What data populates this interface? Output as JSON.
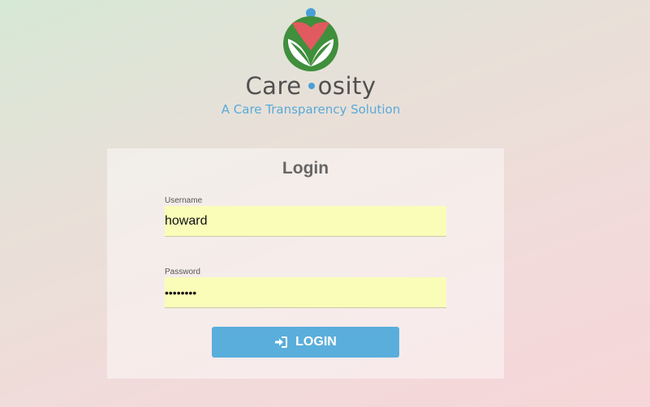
{
  "brand": {
    "name_part_a": "Care",
    "name_part_b": "osity",
    "tagline": "A Care Transparency Solution",
    "colors": {
      "leaf": "#3f8f3c",
      "heart": "#e05a5f",
      "dot": "#4a9fd6"
    }
  },
  "login": {
    "title": "Login",
    "username_label": "Username",
    "username_value": "howard",
    "password_label": "Password",
    "password_value": "••••••••",
    "button_label": "LOGIN",
    "button_icon": "sign-in-icon",
    "button_color": "#5aaedb",
    "input_background": "#fafdb8"
  }
}
